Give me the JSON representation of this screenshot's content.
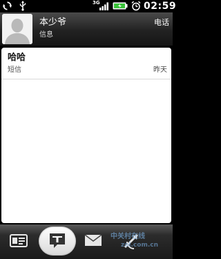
{
  "status_bar": {
    "network": "3G",
    "time": "02:59",
    "icons": [
      "sync-icon",
      "usb-icon",
      "signal-icon",
      "battery-icon",
      "alarm-icon"
    ],
    "battery_color": "#3ac23a"
  },
  "contact": {
    "name": "本少爷",
    "subtitle": "信息",
    "phone_label": "电话",
    "avatar_icon": "person-silhouette-icon"
  },
  "threads": [
    {
      "name": "哈哈",
      "type": "短信",
      "time": "昨天"
    }
  ],
  "tabs": [
    {
      "icon": "contact-card-icon",
      "active": false
    },
    {
      "icon": "message-thread-icon",
      "active": true
    },
    {
      "icon": "mail-icon",
      "active": false
    },
    {
      "icon": "call-log-icon",
      "active": false
    }
  ],
  "watermark": {
    "main": "中关村在线",
    "sub": "zol.com.cn"
  }
}
